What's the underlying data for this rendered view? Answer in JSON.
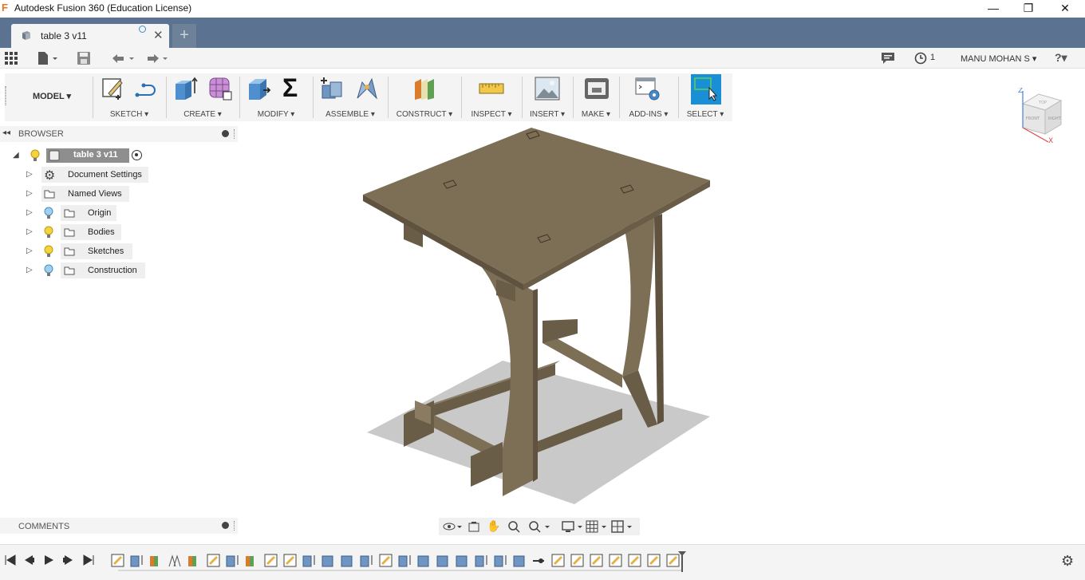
{
  "window": {
    "title": "Autodesk Fusion 360 (Education License)",
    "app_icon": "F",
    "minimize": "—",
    "maximize": "❐",
    "close": "✕"
  },
  "tabs": [
    {
      "label": "table 3 v11",
      "close": "✕"
    }
  ],
  "new_tab": "+",
  "quick_access": {
    "user": "MANU MOHAN S ▾",
    "job_count": "1",
    "help": "?▾"
  },
  "ribbon": {
    "workspace": "MODEL ▾",
    "groups": [
      {
        "label": "SKETCH ▾"
      },
      {
        "label": "CREATE ▾"
      },
      {
        "label": "MODIFY ▾"
      },
      {
        "label": "ASSEMBLE ▾"
      },
      {
        "label": "CONSTRUCT ▾"
      },
      {
        "label": "INSPECT ▾"
      },
      {
        "label": "INSERT ▾"
      },
      {
        "label": "MAKE ▾"
      },
      {
        "label": "ADD-INS ▾"
      },
      {
        "label": "SELECT ▾"
      }
    ],
    "modify_symbol": "Σ"
  },
  "browser": {
    "title": "BROWSER",
    "root": "table 3 v11",
    "items": [
      {
        "label": "Document Settings",
        "icon": "gear-icon"
      },
      {
        "label": "Named Views",
        "icon": "folder-icon"
      },
      {
        "label": "Origin",
        "icon": "folder-icon",
        "bulb": "#9fd0ef"
      },
      {
        "label": "Bodies",
        "icon": "folder-icon",
        "bulb": "#f5d33c"
      },
      {
        "label": "Sketches",
        "icon": "folder-icon",
        "bulb": "#f5d33c"
      },
      {
        "label": "Construction",
        "icon": "folder-icon",
        "bulb": "#9fd0ef"
      }
    ]
  },
  "comments": {
    "title": "COMMENTS"
  },
  "viewcube": {
    "top": "TOP",
    "front": "FRONT",
    "right": "RIGHT",
    "z": "Z",
    "x": "X"
  },
  "colors": {
    "tabbar": "#5b7390",
    "select_active": "#1a8fd6",
    "wood": "#7d6e56",
    "bulb_on": "#f5d33c",
    "bulb_off": "#9fd0ef"
  }
}
